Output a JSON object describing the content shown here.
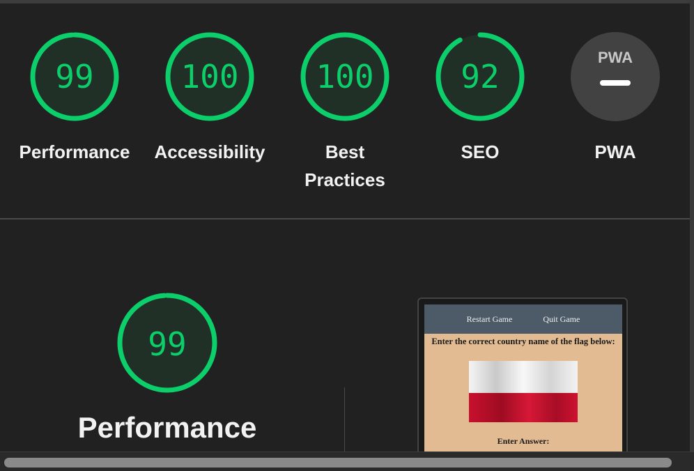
{
  "categories": [
    {
      "id": "performance",
      "score": 99,
      "label": "Performance",
      "color": "#0cce6b"
    },
    {
      "id": "accessibility",
      "score": 100,
      "label": "Accessibility",
      "color": "#0cce6b"
    },
    {
      "id": "best-practices",
      "score": 100,
      "label": "Best Practices",
      "color": "#0cce6b"
    },
    {
      "id": "seo",
      "score": 92,
      "label": "SEO",
      "color": "#0cce6b"
    },
    {
      "id": "pwa",
      "score": null,
      "label": "PWA",
      "badge": "PWA"
    }
  ],
  "performance_section": {
    "score": 99,
    "title": "Performance"
  },
  "screenshot": {
    "nav": {
      "restart": "Restart Game",
      "quit": "Quit Game"
    },
    "prompt": "Enter the correct country name of the flag below:",
    "answer_label": "Enter Answer:"
  },
  "colors": {
    "pass": "#0cce6b",
    "background": "#212121",
    "pwa_gray": "#424242"
  }
}
